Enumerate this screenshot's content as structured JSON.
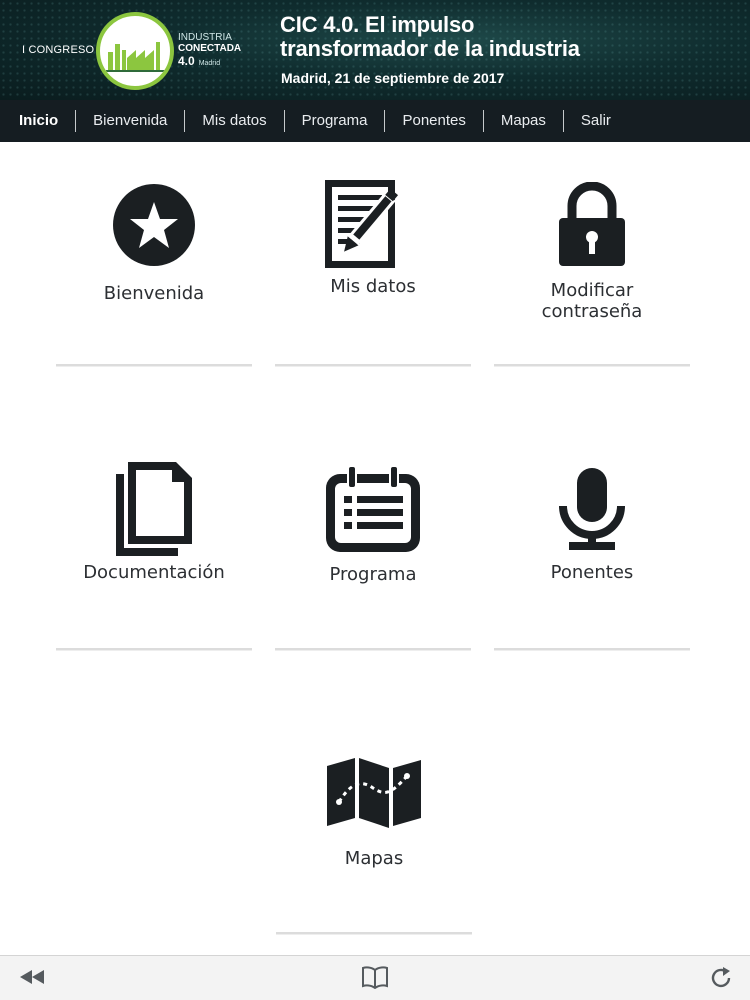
{
  "banner": {
    "congreso": "I CONGRESO",
    "logo_line1": "INDUSTRIA",
    "logo_line2": "CONECTADA",
    "logo_line3": "4.0",
    "logo_city": "Madrid",
    "title_line1": "CIC 4.0. El impulso",
    "title_line2": "transformador de la industria",
    "subtitle": "Madrid, 21 de septiembre de 2017"
  },
  "nav": {
    "items": [
      "Inicio",
      "Bienvenida",
      "Mis datos",
      "Programa",
      "Ponentes",
      "Mapas",
      "Salir"
    ]
  },
  "tiles": {
    "bienvenida": "Bienvenida",
    "mis_datos": "Mis datos",
    "modificar_line1": "Modificar",
    "modificar_line2": "contraseña",
    "documentacion": "Documentación",
    "programa": "Programa",
    "ponentes": "Ponentes",
    "mapas": "Mapas"
  },
  "icons": {
    "tile_icon_color": "#1b1f22",
    "logo_green": "#8cc63f"
  },
  "browser_bar": {
    "back_icon": "rewind-icon",
    "bookmarks_icon": "book-icon",
    "reload_icon": "reload-icon"
  }
}
